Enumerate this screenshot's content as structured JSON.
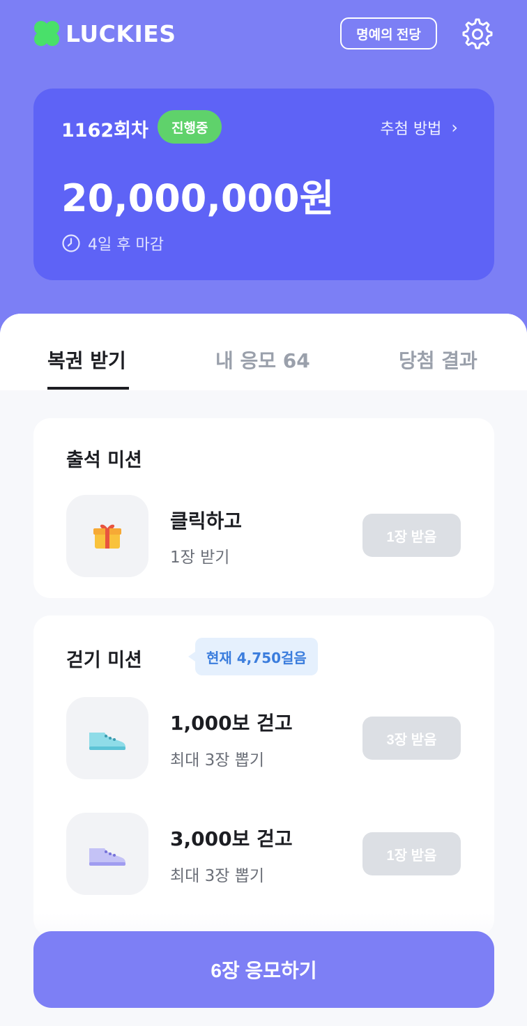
{
  "header": {
    "logo_text": "LUCKIES",
    "hall_of_fame_label": "명예의 전당",
    "settings_icon": "gear-icon"
  },
  "draw": {
    "round": "1162회차",
    "status_badge": "진행중",
    "method_link": "추첨 방법",
    "prize": "20,000,000원",
    "deadline": "4일 후 마감"
  },
  "tabs": [
    {
      "label": "복권 받기",
      "active": true
    },
    {
      "label": "내 응모 64",
      "active": false
    },
    {
      "label": "당첨 결과",
      "active": false
    }
  ],
  "attendance": {
    "title": "출석 미션",
    "items": [
      {
        "icon": "gift-icon",
        "title": "클릭하고",
        "subtitle": "1장 받기",
        "button": "1장 받음"
      }
    ]
  },
  "walking": {
    "title": "걷기 미션",
    "current_steps": "현재 4,750걸음",
    "items": [
      {
        "icon": "shoe-icon",
        "title": "1,000보 걷고",
        "subtitle": "최대 3장 뽑기",
        "button": "3장 받음"
      },
      {
        "icon": "shoe-icon",
        "title": "3,000보 걷고",
        "subtitle": "최대 3장 뽑기",
        "button": "1장 받음"
      }
    ]
  },
  "submit_label": "6장 응모하기",
  "colors": {
    "brand": "#7c7ff5",
    "card": "#5e63f6",
    "live_badge": "#5fd26b",
    "disabled_button": "#dcdfe4",
    "steps_badge_text": "#3b7ddd"
  }
}
